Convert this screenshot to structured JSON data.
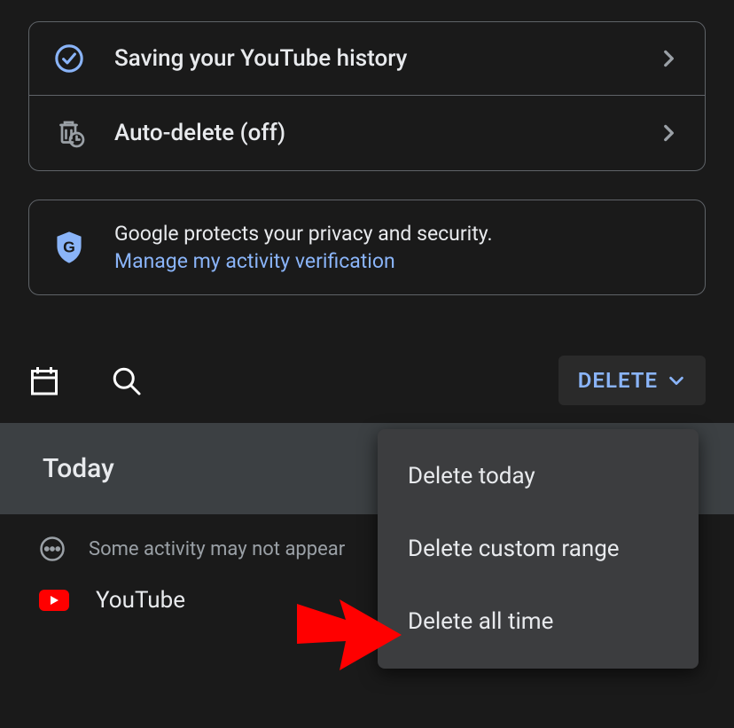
{
  "settings": {
    "saving_history_label": "Saving your YouTube history",
    "auto_delete_label": "Auto-delete (off)"
  },
  "privacy": {
    "text": "Google protects your privacy and security.",
    "link": "Manage my activity verification"
  },
  "toolbar": {
    "delete_label": "DELETE"
  },
  "section": {
    "today": "Today"
  },
  "notice": {
    "text": "Some activity may not appear"
  },
  "app": {
    "name": "YouTube"
  },
  "dropdown": {
    "items": [
      "Delete today",
      "Delete custom range",
      "Delete all time"
    ]
  }
}
